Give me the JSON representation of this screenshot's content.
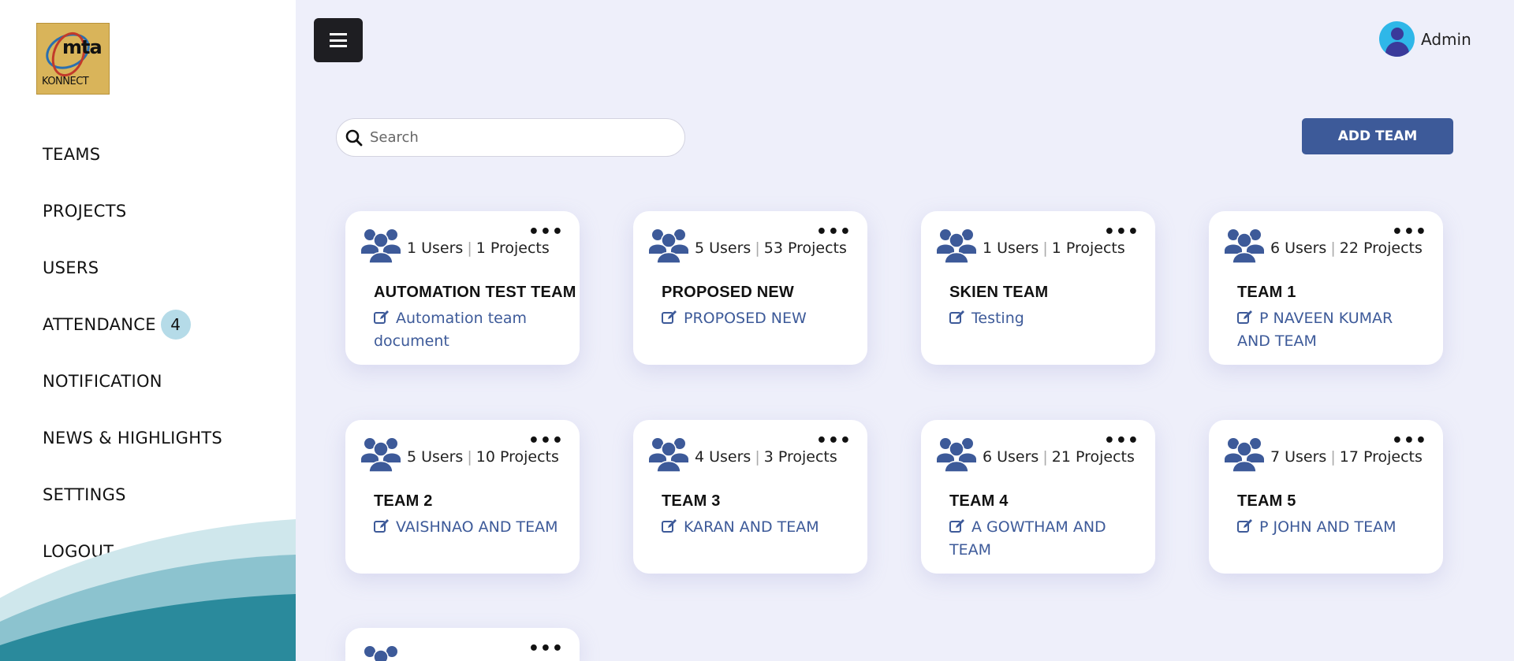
{
  "logo": {
    "brand": "mta",
    "sub": "KONNECT"
  },
  "sidebar": {
    "items": [
      {
        "label": "TEAMS"
      },
      {
        "label": "PROJECTS"
      },
      {
        "label": "USERS"
      },
      {
        "label": "ATTENDANCE",
        "badge": "4"
      },
      {
        "label": "NOTIFICATION"
      },
      {
        "label": "NEWS & HIGHLIGHTS"
      },
      {
        "label": "SETTINGS"
      },
      {
        "label": "LOGOUT"
      }
    ]
  },
  "header": {
    "user_name": "Admin"
  },
  "search": {
    "placeholder": "Search"
  },
  "actions": {
    "add_team_label": "ADD TEAM"
  },
  "teams": [
    {
      "users": "1 Users",
      "projects": "1 Projects",
      "name": "AUTOMATION TEST TEAM",
      "description": "Automation team document"
    },
    {
      "users": "5 Users",
      "projects": "53 Projects",
      "name": "PROPOSED NEW",
      "description": "PROPOSED NEW"
    },
    {
      "users": "1 Users",
      "projects": "1 Projects",
      "name": "SKIEN TEAM",
      "description": "Testing"
    },
    {
      "users": "6 Users",
      "projects": "22 Projects",
      "name": "TEAM 1",
      "description": "P NAVEEN KUMAR AND TEAM"
    },
    {
      "users": "5 Users",
      "projects": "10 Projects",
      "name": "TEAM 2",
      "description": "VAISHNAO AND TEAM"
    },
    {
      "users": "4 Users",
      "projects": "3 Projects",
      "name": "TEAM 3",
      "description": "KARAN AND TEAM"
    },
    {
      "users": "6 Users",
      "projects": "21 Projects",
      "name": "TEAM 4",
      "description": "A GOWTHAM AND TEAM"
    },
    {
      "users": "7 Users",
      "projects": "17 Projects",
      "name": "TEAM 5",
      "description": "P JOHN AND TEAM"
    },
    {
      "users": "",
      "projects": "",
      "name": "",
      "description": ""
    }
  ],
  "colors": {
    "accent": "#3d5a99",
    "badge": "#b5dbe8",
    "background": "#eeeffa",
    "wave": "#2a8a9c"
  },
  "icons": {
    "menu": "hamburger-icon",
    "search": "search-icon",
    "team": "users-group-icon",
    "more": "more-dots-icon",
    "edit": "edit-icon",
    "user": "user-avatar-icon"
  }
}
